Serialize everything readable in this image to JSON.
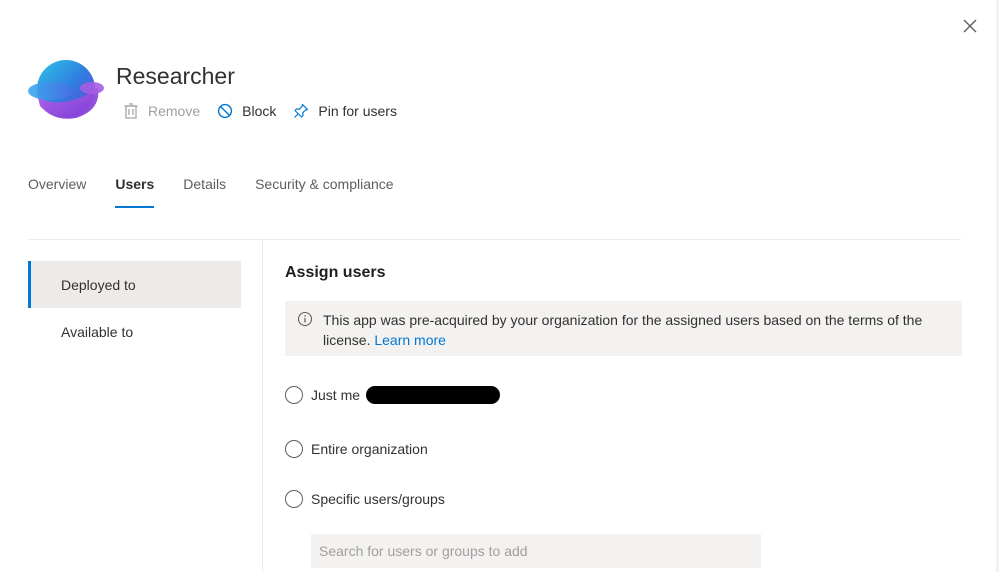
{
  "app": {
    "title": "Researcher"
  },
  "actions": {
    "remove_label": "Remove",
    "block_label": "Block",
    "pin_label": "Pin for users"
  },
  "tabs": [
    {
      "label": "Overview",
      "active": false
    },
    {
      "label": "Users",
      "active": true
    },
    {
      "label": "Details",
      "active": false
    },
    {
      "label": "Security & compliance",
      "active": false
    }
  ],
  "side_nav": [
    {
      "label": "Deployed to",
      "active": true
    },
    {
      "label": "Available to",
      "active": false
    }
  ],
  "assign": {
    "title": "Assign users",
    "info_text": "This app was pre-acquired by your organization for the assigned users based on the terms of the license.",
    "info_link": "Learn more",
    "options": [
      {
        "label": "Just me",
        "selected": false
      },
      {
        "label": "Entire organization",
        "selected": false
      },
      {
        "label": "Specific users/groups",
        "selected": false
      }
    ],
    "search_placeholder": "Search for users or groups to add"
  },
  "colors": {
    "accent": "#0078d4",
    "text": "#323130",
    "muted": "#a19f9d",
    "panel_bg": "#f3f2f1"
  }
}
